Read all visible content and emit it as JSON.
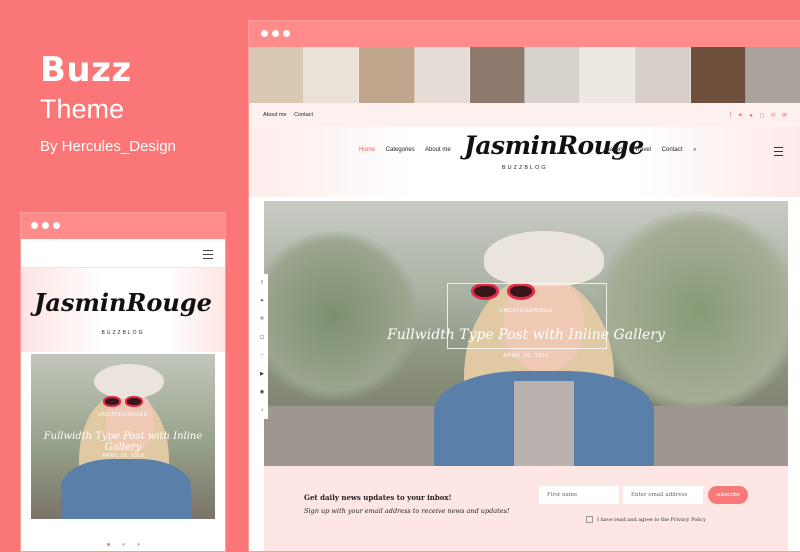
{
  "brand": {
    "name": "Buzz",
    "subtitle": "Theme",
    "author": "By Hercules_Design"
  },
  "colors": {
    "background": "#fb7676",
    "accent": "#f87979",
    "window_bar": "#ff8b8b"
  },
  "desktop": {
    "top_links": [
      "About me",
      "Contact"
    ],
    "social_icons": [
      "facebook-icon",
      "twitter-icon",
      "flickr-icon",
      "instagram-icon",
      "pinterest-icon",
      "email-icon"
    ],
    "menu_left": [
      "Home",
      "Categories",
      "About me"
    ],
    "menu_right": [
      "Gallery",
      "Travel",
      "Contact"
    ],
    "logo": "JasminRouge",
    "logo_sub": "BUZZBLOG",
    "hero": {
      "category": "UNCATEGORIZED",
      "title": "Fullwidth Type Post with Inline Gallery",
      "date": "APRIL 26, 2019"
    },
    "share_icons": [
      "facebook-icon",
      "twitter-icon",
      "pinterest-icon",
      "instagram-icon",
      "heart-icon",
      "youtube-icon",
      "rss-icon",
      "tiktok-icon"
    ],
    "newsletter": {
      "heading": "Get daily news updates to your inbox!",
      "subtext": "Sign up with your email address to receive news and updates!",
      "first_name_placeholder": "First name",
      "email_placeholder": "Enter email address",
      "button": "subscribe",
      "privacy": "I have read and agree to the Privacy Policy"
    }
  },
  "mobile": {
    "logo": "JasminRouge",
    "logo_sub": "BUZZBLOG",
    "hero": {
      "category": "UNCATEGORIZED",
      "title": "Fullwidth Type Post with Inline Gallery",
      "date": "APRIL 26, 2019"
    }
  }
}
